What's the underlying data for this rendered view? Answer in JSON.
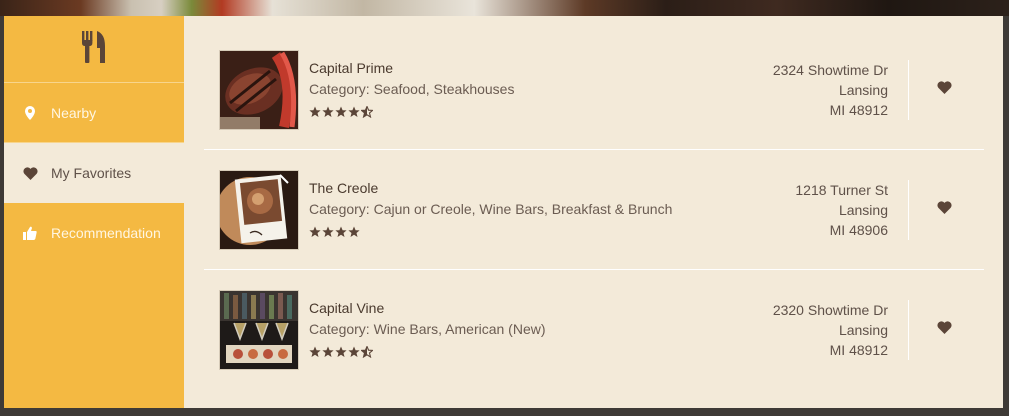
{
  "colors": {
    "sidebar": "#f4b942",
    "content_bg": "#f3ead9",
    "text_dark": "#4a3a2e",
    "icon_brown": "#5b4538"
  },
  "logo": {
    "icon": "fork-knife-icon"
  },
  "nav": {
    "items": [
      {
        "label": "Nearby",
        "icon": "map-pin-icon",
        "active": false
      },
      {
        "label": "My Favorites",
        "icon": "heart-icon",
        "active": true
      },
      {
        "label": "Recommendation",
        "icon": "thumbs-up-icon",
        "active": false
      }
    ]
  },
  "restaurants": [
    {
      "name": "Capital Prime",
      "category": "Category: Seafood, Steakhouses",
      "rating": 4.5,
      "address": {
        "street": "2324 Showtime Dr",
        "city": "Lansing",
        "state_zip": "MI 48912"
      },
      "favorite": true
    },
    {
      "name": "The Creole",
      "category": "Category: Cajun or Creole, Wine Bars, Breakfast & Brunch",
      "rating": 4,
      "address": {
        "street": "1218 Turner St",
        "city": "Lansing",
        "state_zip": "MI 48906"
      },
      "favorite": true
    },
    {
      "name": "Capital Vine",
      "category": "Category: Wine Bars, American (New)",
      "rating": 4.5,
      "address": {
        "street": "2320 Showtime Dr",
        "city": "Lansing",
        "state_zip": "MI 48912"
      },
      "favorite": true
    }
  ]
}
